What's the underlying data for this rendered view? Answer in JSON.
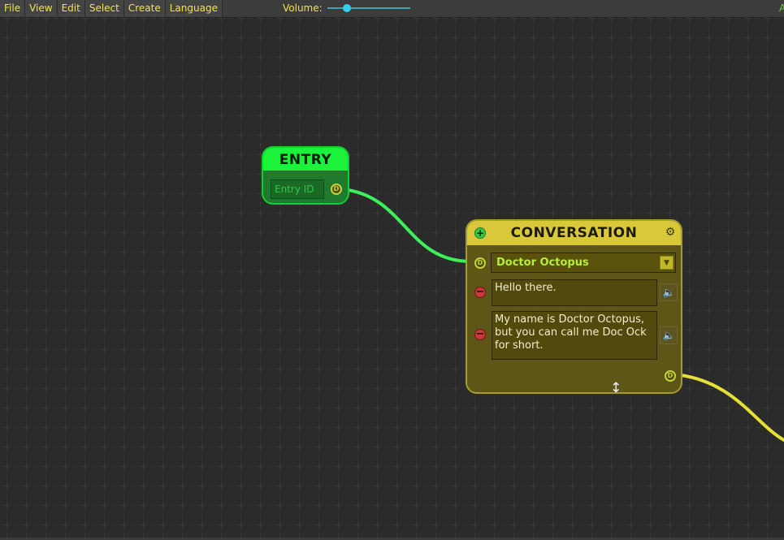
{
  "menu": {
    "items": [
      "File",
      "View",
      "Edit",
      "Select",
      "Create",
      "Language"
    ]
  },
  "volume": {
    "label": "Volume:",
    "value": 0.24
  },
  "colors": {
    "menu_text": "#f2e34c",
    "entry_wire": "#3cf05a",
    "conversation_wire": "#e6df35",
    "grid_line": "#4a4a4a"
  },
  "entry_node": {
    "title": "ENTRY",
    "field_placeholder": "Entry ID",
    "output_port_glyph": "D"
  },
  "conversation_node": {
    "title": "CONVERSATION",
    "add_icon": "plus-icon",
    "settings_icon": "gear-icon",
    "input_port_glyph": "D",
    "output_port_glyph": "D",
    "speaker": "Doctor Octopus",
    "lines": [
      {
        "text": "Hello there.",
        "remove_icon": "minus-icon",
        "audio_icon": "speaker-icon"
      },
      {
        "text": "My name is Doctor Octopus, but you can call me Doc Ock for short.",
        "remove_icon": "minus-icon",
        "audio_icon": "speaker-icon"
      }
    ]
  },
  "cursor": "resize-vertical-cursor"
}
